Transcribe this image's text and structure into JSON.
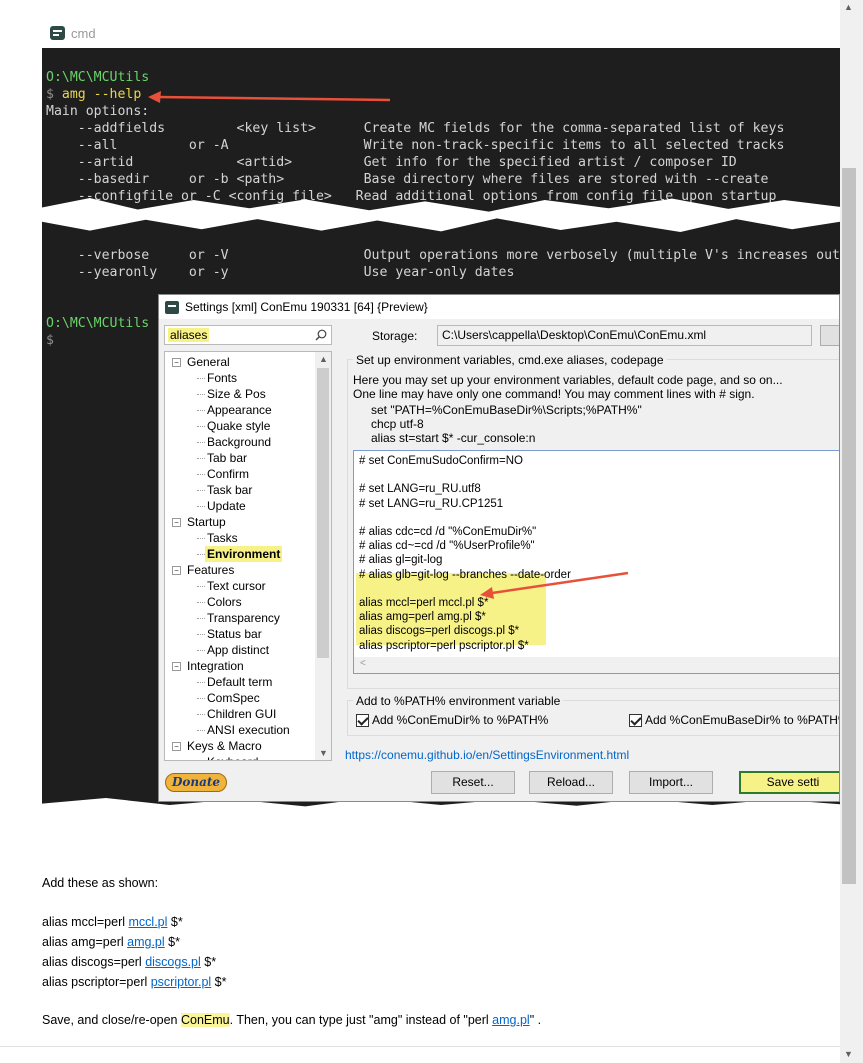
{
  "terminal": {
    "tab_name": "cmd",
    "lines_top": [
      {
        "text": "O:\\MC\\MCUtils",
        "style": "green"
      },
      {
        "prompt": "$ ",
        "command": "amg --help"
      },
      {
        "text": "Main options:"
      },
      {
        "text": "    --addfields         <key list>      Create MC fields for the comma-separated list of keys"
      },
      {
        "text": "    --all         or -A                 Write non-track-specific items to all selected tracks"
      },
      {
        "text": "    --artid             <artid>         Get info for the specified artist / composer ID"
      },
      {
        "text": "    --basedir     or -b <path>          Base directory where files are stored with --create"
      },
      {
        "text": "    --configfile or -C <config file>   Read additional options from config file upon startup"
      }
    ],
    "lines_bottom": [
      {
        "text": "    --verbose     or -V                 Output operations more verbosely (multiple V's increases outp"
      },
      {
        "text": "    --yearonly    or -y                 Use year-only dates"
      }
    ],
    "prompt_path": "O:\\MC\\MCUtils",
    "prompt_symbol": "$"
  },
  "settings": {
    "title": "Settings [xml] ConEmu 190331 [64] {Preview}",
    "search_value": "aliases",
    "storage_label": "Storage:",
    "storage_path": "C:\\Users\\cappella\\Desktop\\ConEmu\\ConEmu.xml",
    "tree": [
      {
        "label": "General",
        "level": 0,
        "expander": "−"
      },
      {
        "label": "Fonts",
        "level": 1
      },
      {
        "label": "Size & Pos",
        "level": 1
      },
      {
        "label": "Appearance",
        "level": 1
      },
      {
        "label": "Quake style",
        "level": 1
      },
      {
        "label": "Background",
        "level": 1
      },
      {
        "label": "Tab bar",
        "level": 1
      },
      {
        "label": "Confirm",
        "level": 1
      },
      {
        "label": "Task bar",
        "level": 1
      },
      {
        "label": "Update",
        "level": 1
      },
      {
        "label": "Startup",
        "level": 0,
        "expander": "−"
      },
      {
        "label": "Tasks",
        "level": 1
      },
      {
        "label": "Environment",
        "level": 1,
        "selected": true
      },
      {
        "label": "Features",
        "level": 0,
        "expander": "−"
      },
      {
        "label": "Text cursor",
        "level": 1
      },
      {
        "label": "Colors",
        "level": 1
      },
      {
        "label": "Transparency",
        "level": 1
      },
      {
        "label": "Status bar",
        "level": 1
      },
      {
        "label": "App distinct",
        "level": 1
      },
      {
        "label": "Integration",
        "level": 0,
        "expander": "−"
      },
      {
        "label": "Default term",
        "level": 1
      },
      {
        "label": "ComSpec",
        "level": 1
      },
      {
        "label": "Children GUI",
        "level": 1
      },
      {
        "label": "ANSI execution",
        "level": 1
      },
      {
        "label": "Keys & Macro",
        "level": 0,
        "expander": "−"
      },
      {
        "label": "Keyboard",
        "level": 1
      }
    ],
    "group_title": "Set up environment variables, cmd.exe aliases, codepage",
    "desc_line1": "Here you may set up your environment variables, default code page, and so on...",
    "desc_line2": "One line may have only one command! You may comment lines with # sign.",
    "example_lines": [
      "set \"PATH=%ConEmuBaseDir%\\Scripts;%PATH%\"",
      "chcp utf-8",
      "alias st=start $* -cur_console:n"
    ],
    "editor_lines": [
      "# set ConEmuSudoConfirm=NO",
      "",
      "# set LANG=ru_RU.utf8",
      "# set LANG=ru_RU.CP1251",
      "",
      "# alias cdc=cd /d \"%ConEmuDir%\"",
      "# alias cd~=cd /d \"%UserProfile%\"",
      "# alias gl=git-log",
      "# alias glb=git-log --branches --date-order",
      "",
      "alias mccl=perl mccl.pl $*",
      "alias amg=perl amg.pl $*",
      "alias discogs=perl discogs.pl $*",
      "alias pscriptor=perl pscriptor.pl $*"
    ],
    "path_group_title": "Add to %PATH% environment variable",
    "check1_label": "Add %ConEmuDir% to %PATH%",
    "check2_label": "Add %ConEmuBaseDir% to %PATH%",
    "help_link": "https://conemu.github.io/en/SettingsEnvironment.html",
    "donate_label": "Donate",
    "reset_label": "Reset...",
    "reload_label": "Reload...",
    "import_label": "Import...",
    "save_label": "Save setti"
  },
  "article": {
    "intro": "Add these as shown:",
    "aliases": [
      {
        "prefix": "alias mccl=perl ",
        "link": "mccl.pl",
        "suffix": " $*"
      },
      {
        "prefix": "alias amg=perl ",
        "link": "amg.pl",
        "suffix": " $*"
      },
      {
        "prefix": "alias discogs=perl ",
        "link": "discogs.pl",
        "suffix": " $*"
      },
      {
        "prefix": "alias pscriptor=perl ",
        "link": "pscriptor.pl",
        "suffix": " $*"
      }
    ],
    "closing_a": "Save, and close/re-open ",
    "closing_hl": "ConEmu",
    "closing_b": ".   Then, you can type just \"amg\" instead of \"perl ",
    "closing_link": "amg.pl",
    "closing_c": "\" ."
  },
  "colors": {
    "terminal_bg": "#1e1e1e",
    "prompt_green": "#6ad46a",
    "highlight_yellow": "#f7f287",
    "arrow_red": "#e8503a",
    "link_blue": "#0066cc"
  }
}
